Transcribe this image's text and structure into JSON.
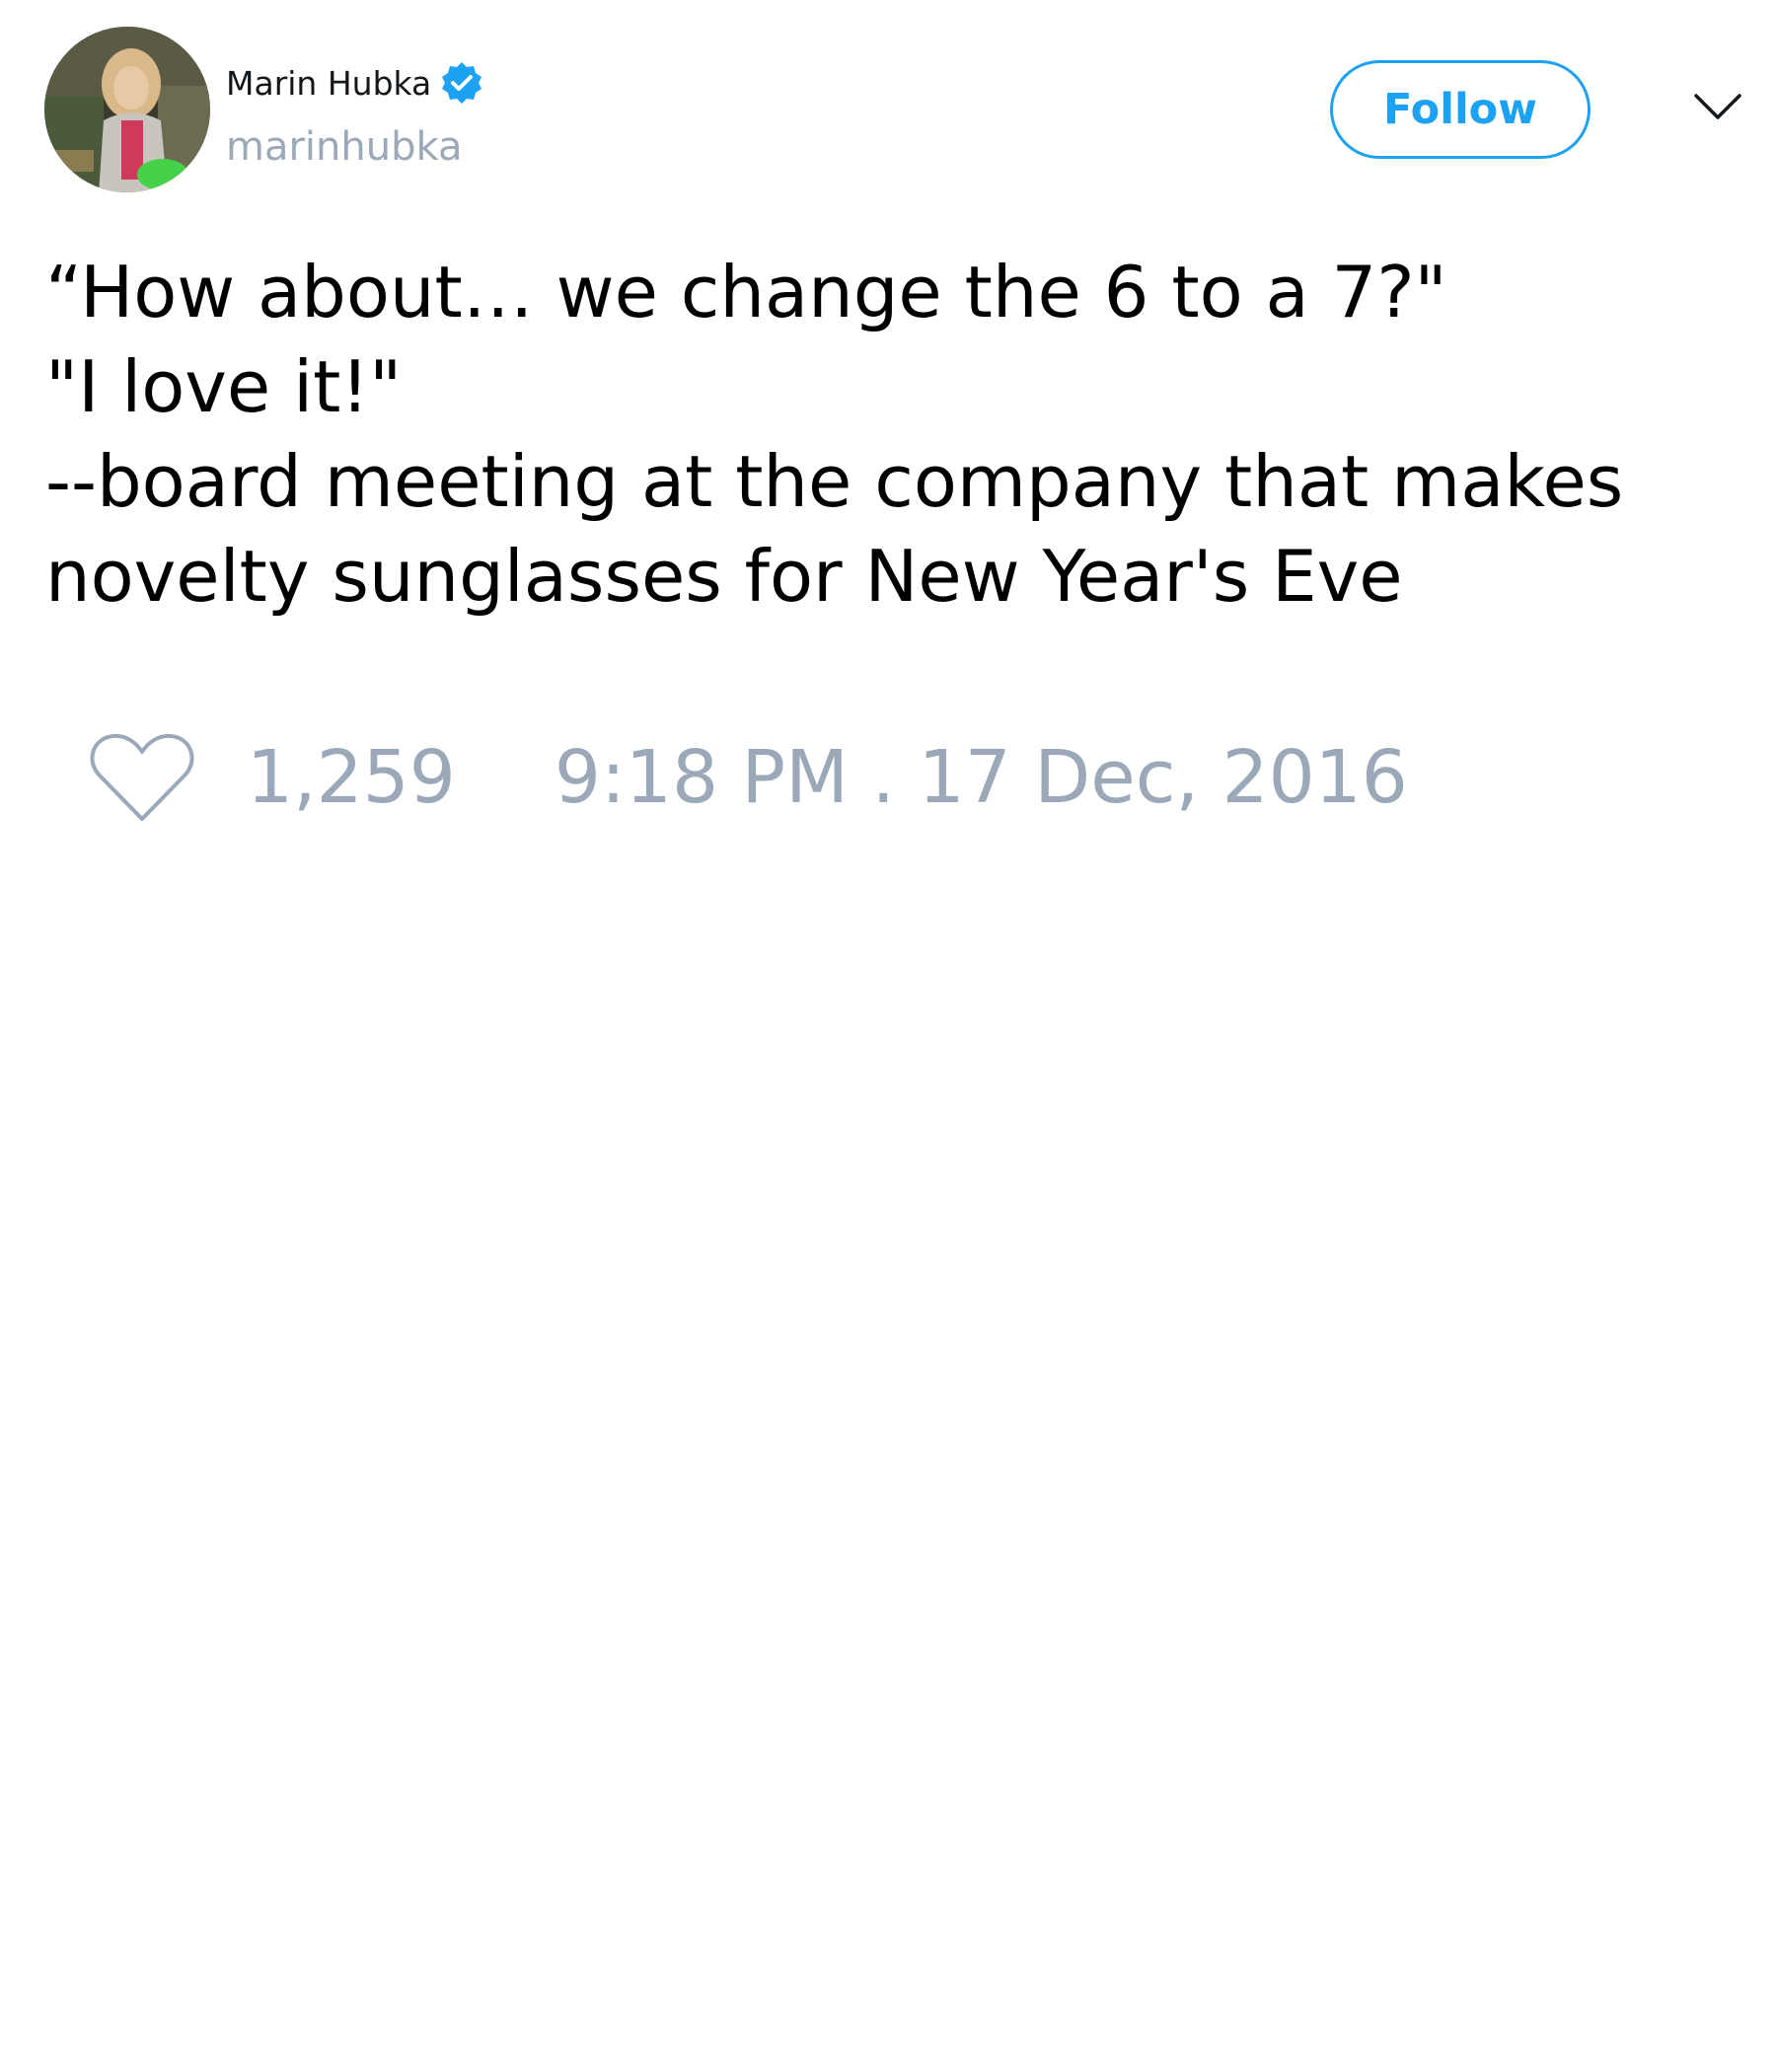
{
  "colors": {
    "accent": "#1da1f2",
    "muted_text": "#9aa8b8",
    "primary_text": "#000000",
    "background": "#ffffff"
  },
  "author": {
    "display_name": "Marin Hubka",
    "handle": "marinhubka",
    "verified": true,
    "verified_icon": "verified-badge-icon",
    "avatar": "profile-photo"
  },
  "header": {
    "follow_label": "Follow",
    "more_icon": "chevron-down-icon"
  },
  "tweet": {
    "lines": [
      "“How about… we change the 6 to a 7?\"",
      "\"I love it!\"",
      "--board meeting at the company that makes",
      "novelty sunglasses for New Year's Eve"
    ]
  },
  "footer": {
    "like_icon": "heart-icon",
    "like_count": "1,259",
    "timestamp": "9:18 PM . 17 Dec, 2016"
  }
}
